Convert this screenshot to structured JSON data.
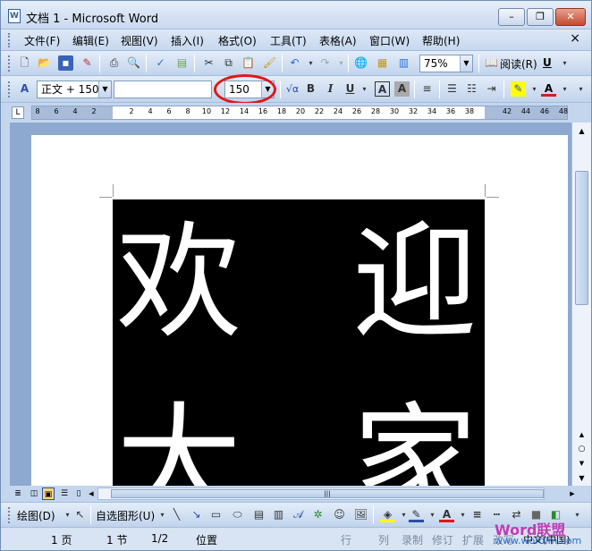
{
  "window": {
    "title": "文档 1 - Microsoft Word",
    "minimize": "–",
    "restore": "❐",
    "close": "✕"
  },
  "menu": {
    "items": [
      "文件(F)",
      "编辑(E)",
      "视图(V)",
      "插入(I)",
      "格式(O)",
      "工具(T)",
      "表格(A)",
      "窗口(W)",
      "帮助(H)"
    ],
    "close_doc": "×"
  },
  "standard_toolbar": {
    "zoom": "75%",
    "read_label": "阅读(R)",
    "underline_label": "U"
  },
  "format_toolbar": {
    "style": "正文 + 150",
    "font": "",
    "font_size": "150",
    "bold": "B",
    "italic": "I",
    "underline": "U",
    "char_border": "A",
    "char_shade": "A"
  },
  "ruler": {
    "ticks": [
      "8",
      "6",
      "4",
      "2",
      "",
      "2",
      "4",
      "6",
      "8",
      "10",
      "12",
      "14",
      "16",
      "18",
      "20",
      "22",
      "24",
      "26",
      "28",
      "30",
      "32",
      "34",
      "36",
      "38",
      "",
      "42",
      "44",
      "46",
      "48"
    ]
  },
  "document": {
    "chars": [
      "欢",
      "迎",
      "大",
      "家"
    ]
  },
  "drawing_toolbar": {
    "draw_label": "绘图(D)",
    "autoshape_label": "自选图形(U)"
  },
  "status": {
    "page": "1 页",
    "section": "1 节",
    "page_of": "1/2",
    "position": "位置",
    "line": "行",
    "column": "列",
    "rec": "录制",
    "trk": "修订",
    "ext": "扩展",
    "ovr": "改写",
    "language": "中文(中国)"
  },
  "watermark": {
    "brand": "Word联盟",
    "url": "www.wordlm.com"
  },
  "colors": {
    "highlight": "#ffff00",
    "font_color": "#e01818",
    "ring": "#e01818"
  }
}
